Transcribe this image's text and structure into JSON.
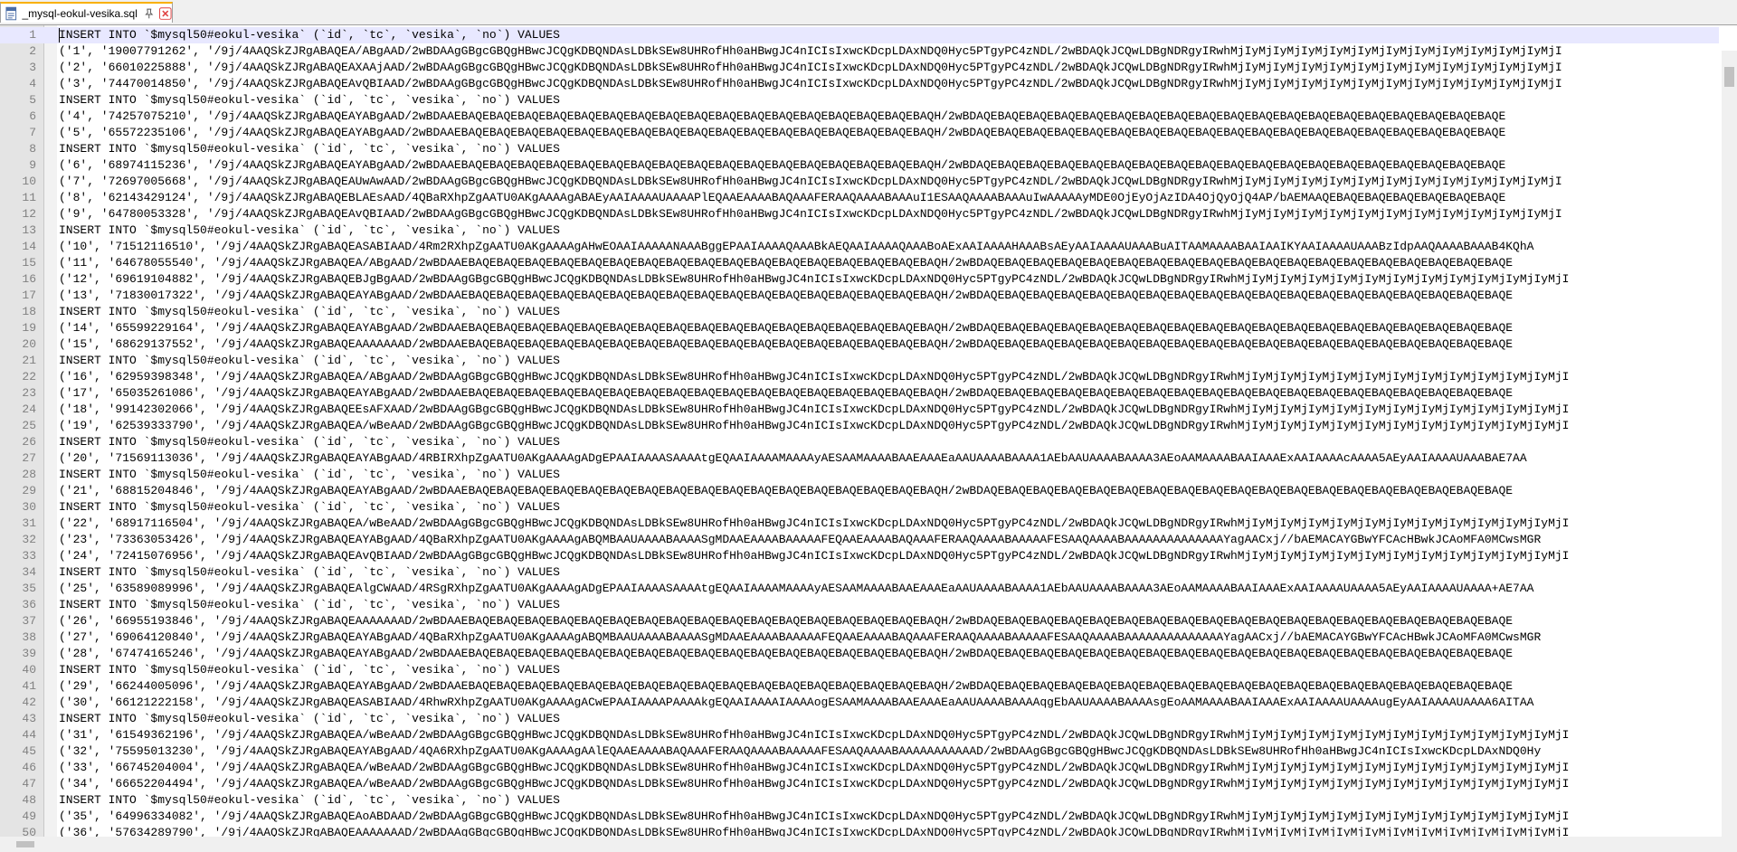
{
  "tab": {
    "title": "_mysql-eokul-vesika.sql",
    "icon": "sql-file-icon",
    "accent": "#f9b000",
    "close_color": "#e04343"
  },
  "lines": [
    {
      "n": "1",
      "text": "INSERT INTO `$mysql50#eokul-vesika` (`id`, `tc`, `vesika`, `no`) VALUES"
    },
    {
      "n": "2",
      "text": "('1', '19007791262', '/9j/4AAQSkZJRgABAQEA/ABgAAD/2wBDAAgGBgcGBQgHBwcJCQgKDBQNDAsLDBkSEw8UHRofHh0aHBwgJC4nICIsIxwcKDcpLDAxNDQ0Hyc5PTgyPC4zNDL/2wBDAQkJCQwLDBgNDRgyIRwhMjIyMjIyMjIyMjIyMjIyMjIyMjIyMjIyMjIyMjIyMjIyMjI"
    },
    {
      "n": "3",
      "text": "('2', '66010225888', '/9j/4AAQSkZJRgABAQEAXAAjAAD/2wBDAAgGBgcGBQgHBwcJCQgKDBQNDAsLDBkSEw8UHRofHh0aHBwgJC4nICIsIxwcKDcpLDAxNDQ0Hyc5PTgyPC4zNDL/2wBDAQkJCQwLDBgNDRgyIRwhMjIyMjIyMjIyMjIyMjIyMjIyMjIyMjIyMjIyMjIyMjIyMjI"
    },
    {
      "n": "4",
      "text": "('3', '74470014850', '/9j/4AAQSkZJRgABAQEAvQBIAAD/2wBDAAgGBgcGBQgHBwcJCQgKDBQNDAsLDBkSEw8UHRofHh0aHBwgJC4nICIsIxwcKDcpLDAxNDQ0Hyc5PTgyPC4zNDL/2wBDAQkJCQwLDBgNDRgyIRwhMjIyMjIyMjIyMjIyMjIyMjIyMjIyMjIyMjIyMjIyMjIyMjI"
    },
    {
      "n": "5",
      "text": "INSERT INTO `$mysql50#eokul-vesika` (`id`, `tc`, `vesika`, `no`) VALUES"
    },
    {
      "n": "6",
      "text": "('4', '74257075210', '/9j/4AAQSkZJRgABAQEAYABgAAD/2wBDAAEBAQEBAQEBAQEBAQEBAQEBAQEBAQEBAQEBAQEBAQEBAQEBAQEBAQEBAQEBAQEBAQEBAQH/2wBDAQEBAQEBAQEBAQEBAQEBAQEBAQEBAQEBAQEBAQEBAQEBAQEBAQEBAQEBAQEBAQEBAQEBAQEBAQE"
    },
    {
      "n": "7",
      "text": "('5', '65572235106', '/9j/4AAQSkZJRgABAQEAYABgAAD/2wBDAAEBAQEBAQEBAQEBAQEBAQEBAQEBAQEBAQEBAQEBAQEBAQEBAQEBAQEBAQEBAQEBAQEBAQH/2wBDAQEBAQEBAQEBAQEBAQEBAQEBAQEBAQEBAQEBAQEBAQEBAQEBAQEBAQEBAQEBAQEBAQEBAQEBAQE"
    },
    {
      "n": "8",
      "text": "INSERT INTO `$mysql50#eokul-vesika` (`id`, `tc`, `vesika`, `no`) VALUES"
    },
    {
      "n": "9",
      "text": "('6', '68974115236', '/9j/4AAQSkZJRgABAQEAYABgAAD/2wBDAAEBAQEBAQEBAQEBAQEBAQEBAQEBAQEBAQEBAQEBAQEBAQEBAQEBAQEBAQEBAQEBAQEBAQH/2wBDAQEBAQEBAQEBAQEBAQEBAQEBAQEBAQEBAQEBAQEBAQEBAQEBAQEBAQEBAQEBAQEBAQEBAQEBAQE"
    },
    {
      "n": "10",
      "text": "('7', '72697005668', '/9j/4AAQSkZJRgABAQEAUwAwAAD/2wBDAAgGBgcGBQgHBwcJCQgKDBQNDAsLDBkSEw8UHRofHh0aHBwgJC4nICIsIxwcKDcpLDAxNDQ0Hyc5PTgyPC4zNDL/2wBDAQkJCQwLDBgNDRgyIRwhMjIyMjIyMjIyMjIyMjIyMjIyMjIyMjIyMjIyMjIyMjIyMjI"
    },
    {
      "n": "11",
      "text": "('8', '62143429124', '/9j/4AAQSkZJRgABAQEBLAEsAAD/4QBaRXhpZgAATU0AKgAAAAgABAEyAAIAAAAUAAAAPlEQAAEAAAABAQAAAFERAAQAAAABAAAuI1ESAAQAAAABAAAuIwAAAAAyMDE0OjEyOjAzIDA4OjQyOjQ4AP/bAEMAAQEBAQEBAQEBAQEBAQEBAQEBAQE"
    },
    {
      "n": "12",
      "text": "('9', '64780053328', '/9j/4AAQSkZJRgABAQEAvQBIAAD/2wBDAAgGBgcGBQgHBwcJCQgKDBQNDAsLDBkSEw8UHRofHh0aHBwgJC4nICIsIxwcKDcpLDAxNDQ0Hyc5PTgyPC4zNDL/2wBDAQkJCQwLDBgNDRgyIRwhMjIyMjIyMjIyMjIyMjIyMjIyMjIyMjIyMjIyMjIyMjIyMjI"
    },
    {
      "n": "13",
      "text": "INSERT INTO `$mysql50#eokul-vesika` (`id`, `tc`, `vesika`, `no`) VALUES"
    },
    {
      "n": "14",
      "text": "('10', '71512116510', '/9j/4AAQSkZJRgABAQEASABIAAD/4Rm2RXhpZgAATU0AKgAAAAgAHwEOAAIAAAAANAAABggEPAAIAAAAQAAABkAEQAAIAAAAQAAABoAExAAIAAAAHAAABsAEyAAIAAAAUAAABuAITAAMAAAABAAIAAIKYAAIAAAAUAAABzIdpAAQAAAABAAAB4KQhA"
    },
    {
      "n": "15",
      "text": "('11', '64678055540', '/9j/4AAQSkZJRgABAQEA/ABgAAD/2wBDAAEBAQEBAQEBAQEBAQEBAQEBAQEBAQEBAQEBAQEBAQEBAQEBAQEBAQEBAQEBAQEBAQEBAQH/2wBDAQEBAQEBAQEBAQEBAQEBAQEBAQEBAQEBAQEBAQEBAQEBAQEBAQEBAQEBAQEBAQEBAQEBAQEBAQE"
    },
    {
      "n": "16",
      "text": "('12', '69619104882', '/9j/4AAQSkZJRgABAQEBJgBgAAD/2wBDAAgGBgcGBQgHBwcJCQgKDBQNDAsLDBkSEw8UHRofHh0aHBwgJC4nICIsIxwcKDcpLDAxNDQ0Hyc5PTgyPC4zNDL/2wBDAQkJCQwLDBgNDRgyIRwhMjIyMjIyMjIyMjIyMjIyMjIyMjIyMjIyMjIyMjIyMjIyMjI"
    },
    {
      "n": "17",
      "text": "('13', '71830017322', '/9j/4AAQSkZJRgABAQEAYABgAAD/2wBDAAEBAQEBAQEBAQEBAQEBAQEBAQEBAQEBAQEBAQEBAQEBAQEBAQEBAQEBAQEBAQEBAQEBAQH/2wBDAQEBAQEBAQEBAQEBAQEBAQEBAQEBAQEBAQEBAQEBAQEBAQEBAQEBAQEBAQEBAQEBAQEBAQEBAQE"
    },
    {
      "n": "18",
      "text": "INSERT INTO `$mysql50#eokul-vesika` (`id`, `tc`, `vesika`, `no`) VALUES"
    },
    {
      "n": "19",
      "text": "('14', '65599229164', '/9j/4AAQSkZJRgABAQEAYABgAAD/2wBDAAEBAQEBAQEBAQEBAQEBAQEBAQEBAQEBAQEBAQEBAQEBAQEBAQEBAQEBAQEBAQEBAQEBAQH/2wBDAQEBAQEBAQEBAQEBAQEBAQEBAQEBAQEBAQEBAQEBAQEBAQEBAQEBAQEBAQEBAQEBAQEBAQEBAQE"
    },
    {
      "n": "20",
      "text": "('15', '68629137552', '/9j/4AAQSkZJRgABAQEAAAAAAAD/2wBDAAEBAQEBAQEBAQEBAQEBAQEBAQEBAQEBAQEBAQEBAQEBAQEBAQEBAQEBAQEBAQEBAQEBAQH/2wBDAQEBAQEBAQEBAQEBAQEBAQEBAQEBAQEBAQEBAQEBAQEBAQEBAQEBAQEBAQEBAQEBAQEBAQEBAQE"
    },
    {
      "n": "21",
      "text": "INSERT INTO `$mysql50#eokul-vesika` (`id`, `tc`, `vesika`, `no`) VALUES"
    },
    {
      "n": "22",
      "text": "('16', '62959398348', '/9j/4AAQSkZJRgABAQEA/ABgAAD/2wBDAAgGBgcGBQgHBwcJCQgKDBQNDAsLDBkSEw8UHRofHh0aHBwgJC4nICIsIxwcKDcpLDAxNDQ0Hyc5PTgyPC4zNDL/2wBDAQkJCQwLDBgNDRgyIRwhMjIyMjIyMjIyMjIyMjIyMjIyMjIyMjIyMjIyMjIyMjIyMjI"
    },
    {
      "n": "23",
      "text": "('17', '65035261086', '/9j/4AAQSkZJRgABAQEAYABgAAD/2wBDAAEBAQEBAQEBAQEBAQEBAQEBAQEBAQEBAQEBAQEBAQEBAQEBAQEBAQEBAQEBAQEBAQEBAQH/2wBDAQEBAQEBAQEBAQEBAQEBAQEBAQEBAQEBAQEBAQEBAQEBAQEBAQEBAQEBAQEBAQEBAQEBAQEBAQE"
    },
    {
      "n": "24",
      "text": "('18', '99142302066', '/9j/4AAQSkZJRgABAQEEsAFXAAD/2wBDAAgGBgcGBQgHBwcJCQgKDBQNDAsLDBkSEw8UHRofHh0aHBwgJC4nICIsIxwcKDcpLDAxNDQ0Hyc5PTgyPC4zNDL/2wBDAQkJCQwLDBgNDRgyIRwhMjIyMjIyMjIyMjIyMjIyMjIyMjIyMjIyMjIyMjIyMjIyMjI"
    },
    {
      "n": "25",
      "text": "('19', '62539333790', '/9j/4AAQSkZJRgABAQEA/wBeAAD/2wBDAAgGBgcGBQgHBwcJCQgKDBQNDAsLDBkSEw8UHRofHh0aHBwgJC4nICIsIxwcKDcpLDAxNDQ0Hyc5PTgyPC4zNDL/2wBDAQkJCQwLDBgNDRgyIRwhMjIyMjIyMjIyMjIyMjIyMjIyMjIyMjIyMjIyMjIyMjIyMjI"
    },
    {
      "n": "26",
      "text": "INSERT INTO `$mysql50#eokul-vesika` (`id`, `tc`, `vesika`, `no`) VALUES"
    },
    {
      "n": "27",
      "text": "('20', '71569113036', '/9j/4AAQSkZJRgABAQEAYABgAAD/4RBIRXhpZgAATU0AKgAAAAgADgEPAAIAAAASAAAAtgEQAAIAAAAMAAAAyAESAAMAAAABAAEAAAEaAAUAAAABAAAA1AEbAAUAAAABAAAA3AEoAAMAAAABAAIAAAExAAIAAAAcAAAA5AEyAAIAAAAUAAABAE7AA"
    },
    {
      "n": "28",
      "text": "INSERT INTO `$mysql50#eokul-vesika` (`id`, `tc`, `vesika`, `no`) VALUES"
    },
    {
      "n": "29",
      "text": "('21', '68815204846', '/9j/4AAQSkZJRgABAQEAYABgAAD/2wBDAAEBAQEBAQEBAQEBAQEBAQEBAQEBAQEBAQEBAQEBAQEBAQEBAQEBAQEBAQEBAQEBAQEBAQH/2wBDAQEBAQEBAQEBAQEBAQEBAQEBAQEBAQEBAQEBAQEBAQEBAQEBAQEBAQEBAQEBAQEBAQEBAQEBAQE"
    },
    {
      "n": "30",
      "text": "INSERT INTO `$mysql50#eokul-vesika` (`id`, `tc`, `vesika`, `no`) VALUES"
    },
    {
      "n": "31",
      "text": "('22', '68917116504', '/9j/4AAQSkZJRgABAQEA/wBeAAD/2wBDAAgGBgcGBQgHBwcJCQgKDBQNDAsLDBkSEw8UHRofHh0aHBwgJC4nICIsIxwcKDcpLDAxNDQ0Hyc5PTgyPC4zNDL/2wBDAQkJCQwLDBgNDRgyIRwhMjIyMjIyMjIyMjIyMjIyMjIyMjIyMjIyMjIyMjIyMjIyMjI"
    },
    {
      "n": "32",
      "text": "('23', '73363053426', '/9j/4AAQSkZJRgABAQEAYABgAAD/4QBaRXhpZgAATU0AKgAAAAgABQMBAAUAAAABAAAASgMDAAEAAAABAAAAAFEQAAEAAAABAQAAAFERAAQAAAABAAAAAFESAAQAAAABAAAAAAAAAAAAAAYagAACxj//bAEMACAYGBwYFCAcHBwkJCAoMFA0MCwsMGR"
    },
    {
      "n": "33",
      "text": "('24', '72415076956', '/9j/4AAQSkZJRgABAQEAvQBIAAD/2wBDAAgGBgcGBQgHBwcJCQgKDBQNDAsLDBkSEw8UHRofHh0aHBwgJC4nICIsIxwcKDcpLDAxNDQ0Hyc5PTgyPC4zNDL/2wBDAQkJCQwLDBgNDRgyIRwhMjIyMjIyMjIyMjIyMjIyMjIyMjIyMjIyMjIyMjIyMjIyMjI"
    },
    {
      "n": "34",
      "text": "INSERT INTO `$mysql50#eokul-vesika` (`id`, `tc`, `vesika`, `no`) VALUES"
    },
    {
      "n": "35",
      "text": "('25', '63589089996', '/9j/4AAQSkZJRgABAQEAlgCWAAD/4RSgRXhpZgAATU0AKgAAAAgADgEPAAIAAAASAAAAtgEQAAIAAAAMAAAAyAESAAMAAAABAAEAAAEaAAUAAAABAAAA1AEbAAUAAAABAAAA3AEoAAMAAAABAAIAAAExAAIAAAAUAAAA5AEyAAIAAAAUAAAA+AE7AA"
    },
    {
      "n": "36",
      "text": "INSERT INTO `$mysql50#eokul-vesika` (`id`, `tc`, `vesika`, `no`) VALUES"
    },
    {
      "n": "37",
      "text": "('26', '66955193846', '/9j/4AAQSkZJRgABAQEAAAAAAAD/2wBDAAEBAQEBAQEBAQEBAQEBAQEBAQEBAQEBAQEBAQEBAQEBAQEBAQEBAQEBAQEBAQEBAQEBAQH/2wBDAQEBAQEBAQEBAQEBAQEBAQEBAQEBAQEBAQEBAQEBAQEBAQEBAQEBAQEBAQEBAQEBAQEBAQEBAQE"
    },
    {
      "n": "38",
      "text": "('27', '69064120840', '/9j/4AAQSkZJRgABAQEAYABgAAD/4QBaRXhpZgAATU0AKgAAAAgABQMBAAUAAAABAAAASgMDAAEAAAABAAAAAFEQAAEAAAABAQAAAFERAAQAAAABAAAAAFESAAQAAAABAAAAAAAAAAAAAAYagAACxj//bAEMACAYGBwYFCAcHBwkJCAoMFA0MCwsMGR"
    },
    {
      "n": "39",
      "text": "('28', '67474165246', '/9j/4AAQSkZJRgABAQEAYABgAAD/2wBDAAEBAQEBAQEBAQEBAQEBAQEBAQEBAQEBAQEBAQEBAQEBAQEBAQEBAQEBAQEBAQEBAQEBAQH/2wBDAQEBAQEBAQEBAQEBAQEBAQEBAQEBAQEBAQEBAQEBAQEBAQEBAQEBAQEBAQEBAQEBAQEBAQEBAQE"
    },
    {
      "n": "40",
      "text": "INSERT INTO `$mysql50#eokul-vesika` (`id`, `tc`, `vesika`, `no`) VALUES"
    },
    {
      "n": "41",
      "text": "('29', '66244005096', '/9j/4AAQSkZJRgABAQEAYABgAAD/2wBDAAEBAQEBAQEBAQEBAQEBAQEBAQEBAQEBAQEBAQEBAQEBAQEBAQEBAQEBAQEBAQEBAQEBAQH/2wBDAQEBAQEBAQEBAQEBAQEBAQEBAQEBAQEBAQEBAQEBAQEBAQEBAQEBAQEBAQEBAQEBAQEBAQEBAQE"
    },
    {
      "n": "42",
      "text": "('30', '66121222158', '/9j/4AAQSkZJRgABAQEASABIAAD/4RhwRXhpZgAATU0AKgAAAAgACwEPAAIAAAAPAAAAkgEQAAIAAAAIAAAAogESAAMAAAABAAEAAAEaAAUAAAABAAAAqgEbAAUAAAABAAAAsgEoAAMAAAABAAIAAAExAAIAAAAUAAAAugEyAAIAAAAUAAAA6AITAA"
    },
    {
      "n": "43",
      "text": "INSERT INTO `$mysql50#eokul-vesika` (`id`, `tc`, `vesika`, `no`) VALUES"
    },
    {
      "n": "44",
      "text": "('31', '61549362196', '/9j/4AAQSkZJRgABAQEA/wBeAAD/2wBDAAgGBgcGBQgHBwcJCQgKDBQNDAsLDBkSEw8UHRofHh0aHBwgJC4nICIsIxwcKDcpLDAxNDQ0Hyc5PTgyPC4zNDL/2wBDAQkJCQwLDBgNDRgyIRwhMjIyMjIyMjIyMjIyMjIyMjIyMjIyMjIyMjIyMjIyMjIyMjI"
    },
    {
      "n": "45",
      "text": "('32', '75595013230', '/9j/4AAQSkZJRgABAQEAYABgAAD/4QA6RXhpZgAATU0AKgAAAAgAAlEQAAEAAAABAQAAAFERAAQAAAABAAAAAFESAAQAAAABAAAAAAAAAAAD/2wBDAAgGBgcGBQgHBwcJCQgKDBQNDAsLDBkSEw8UHRofHh0aHBwgJC4nICIsIxwcKDcpLDAxNDQ0Hy"
    },
    {
      "n": "46",
      "text": "('33', '66745204004', '/9j/4AAQSkZJRgABAQEA/wBeAAD/2wBDAAgGBgcGBQgHBwcJCQgKDBQNDAsLDBkSEw8UHRofHh0aHBwgJC4nICIsIxwcKDcpLDAxNDQ0Hyc5PTgyPC4zNDL/2wBDAQkJCQwLDBgNDRgyIRwhMjIyMjIyMjIyMjIyMjIyMjIyMjIyMjIyMjIyMjIyMjIyMjI"
    },
    {
      "n": "47",
      "text": "('34', '66652204494', '/9j/4AAQSkZJRgABAQEA/wBeAAD/2wBDAAgGBgcGBQgHBwcJCQgKDBQNDAsLDBkSEw8UHRofHh0aHBwgJC4nICIsIxwcKDcpLDAxNDQ0Hyc5PTgyPC4zNDL/2wBDAQkJCQwLDBgNDRgyIRwhMjIyMjIyMjIyMjIyMjIyMjIyMjIyMjIyMjIyMjIyMjIyMjI"
    },
    {
      "n": "48",
      "text": "INSERT INTO `$mysql50#eokul-vesika` (`id`, `tc`, `vesika`, `no`) VALUES"
    },
    {
      "n": "49",
      "text": "('35', '64996334082', '/9j/4AAQSkZJRgABAQEAoABDAAD/2wBDAAgGBgcGBQgHBwcJCQgKDBQNDAsLDBkSEw8UHRofHh0aHBwgJC4nICIsIxwcKDcpLDAxNDQ0Hyc5PTgyPC4zNDL/2wBDAQkJCQwLDBgNDRgyIRwhMjIyMjIyMjIyMjIyMjIyMjIyMjIyMjIyMjIyMjIyMjIyMjI"
    },
    {
      "n": "50",
      "text": "('36', '57634289790', '/9j/4AAQSkZJRgABAQEAAAAAAAD/2wBDAAgGBgcGBQgHBwcJCQgKDBQNDAsLDBkSEw8UHRofHh0aHBwgJC4nICIsIxwcKDcpLDAxNDQ0Hyc5PTgyPC4zNDL/2wBDAQkJCQwLDBgNDRgyIRwhMjIyMjIyMjIyMjIyMjIyMjIyMjIyMjIyMjIyMjIyMjIyMjI"
    }
  ]
}
